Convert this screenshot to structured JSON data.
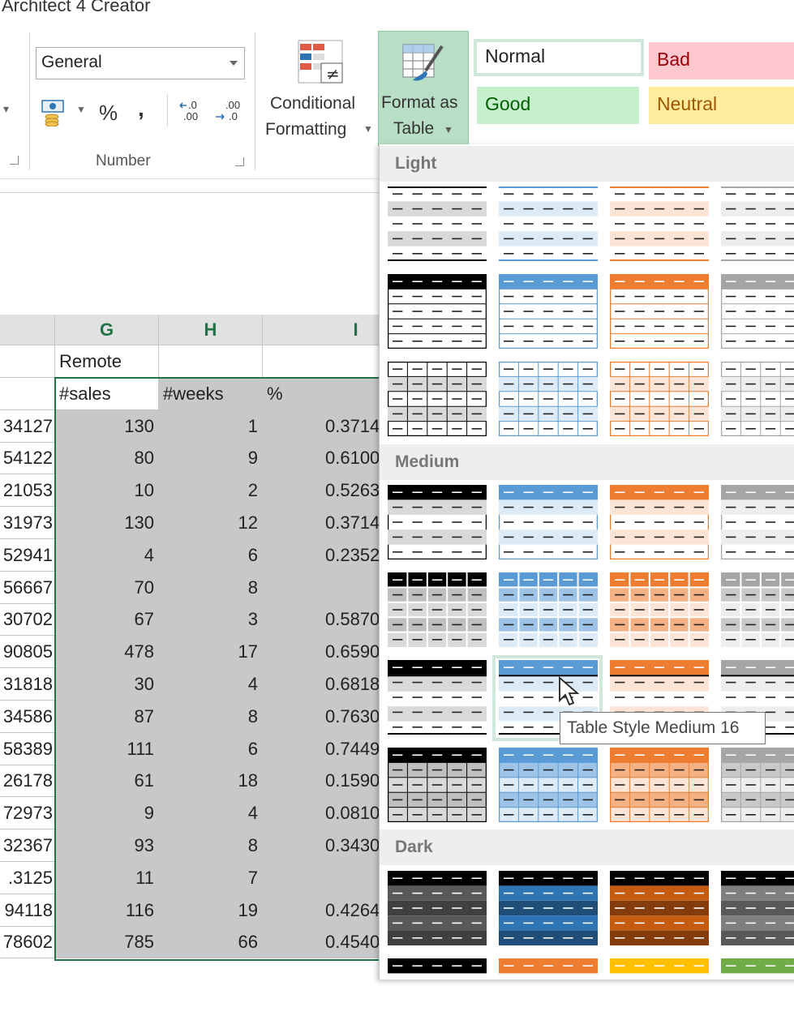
{
  "title": "Architect 4 Creator",
  "ribbon": {
    "number_format_value": "General",
    "percent_label": "%",
    "comma_label": ",",
    "group_number_label": "Number",
    "cond_format_line1": "Conditional",
    "cond_format_line2": "Formatting",
    "format_table_line1": "Format as",
    "format_table_line2": "Table",
    "cell_styles": {
      "normal": "Normal",
      "bad": "Bad",
      "good": "Good",
      "neutral": "Neutral"
    }
  },
  "sheet": {
    "columns": [
      "G",
      "H",
      "I"
    ],
    "header_row": [
      "Remote",
      "",
      ""
    ],
    "sub_header": [
      "#sales",
      "#weeks",
      "%"
    ],
    "left_partial": [
      "34127",
      "54122",
      "21053",
      "31973",
      "52941",
      "56667",
      "30702",
      "90805",
      "31818",
      "34586",
      "58389",
      "26178",
      "72973",
      "32367",
      ".3125",
      "94118",
      "78602"
    ],
    "rows": [
      [
        "130",
        "1",
        "0.3714"
      ],
      [
        "80",
        "9",
        "0.6100"
      ],
      [
        "10",
        "2",
        "0.5263"
      ],
      [
        "130",
        "12",
        "0.3714"
      ],
      [
        "4",
        "6",
        "0.2352"
      ],
      [
        "70",
        "8",
        ""
      ],
      [
        "67",
        "3",
        "0.5870"
      ],
      [
        "478",
        "17",
        "0.6590"
      ],
      [
        "30",
        "4",
        "0.6818"
      ],
      [
        "87",
        "8",
        "0.7630"
      ],
      [
        "111",
        "6",
        "0.7449"
      ],
      [
        "61",
        "18",
        "0.1590"
      ],
      [
        "9",
        "4",
        "0.0810"
      ],
      [
        "93",
        "8",
        "0.3430"
      ],
      [
        "11",
        "7",
        ""
      ],
      [
        "116",
        "19",
        "0.4264"
      ],
      [
        "785",
        "66",
        "0.4540"
      ]
    ]
  },
  "gallery": {
    "light_label": "Light",
    "medium_label": "Medium",
    "dark_label": "Dark",
    "tooltip": "Table Style Medium 16"
  },
  "colors": {
    "accent_green": "#217346",
    "blue": "#5b9bd5",
    "orange": "#ed7d31",
    "gray": "#a5a5a5",
    "gold": "#ffc000",
    "green_theme": "#70ad47"
  }
}
